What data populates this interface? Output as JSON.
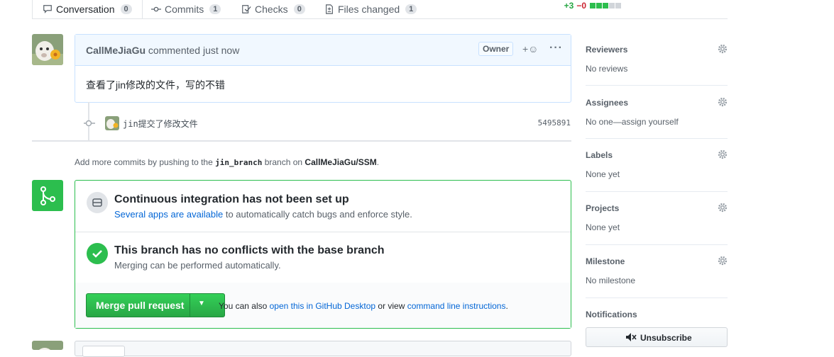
{
  "tabs": {
    "conversation": {
      "label": "Conversation",
      "count": "0"
    },
    "commits": {
      "label": "Commits",
      "count": "1"
    },
    "checks": {
      "label": "Checks",
      "count": "0"
    },
    "files": {
      "label": "Files changed",
      "count": "1"
    }
  },
  "diffstat": {
    "additions": "+3",
    "deletions": "−0"
  },
  "comment": {
    "author": "CallMeJiaGu",
    "action": "commented just now",
    "badge": "Owner",
    "reaction": "+☺",
    "menu": "···",
    "body": "查看了jin修改的文件，写的不错"
  },
  "commit": {
    "message": "jin提交了修改文件",
    "sha": "5495891"
  },
  "hint": {
    "prefix": "Add more commits by pushing to the",
    "branch": "jin_branch",
    "middle": "branch on",
    "repo": "CallMeJiaGu/SSM",
    "end": "."
  },
  "merge": {
    "ci_title": "Continuous integration has not been set up",
    "ci_link": "Several apps are available",
    "ci_rest": "to automatically catch bugs and enforce style.",
    "conflict_title": "This branch has no conflicts with the base branch",
    "conflict_sub": "Merging can be performed automatically.",
    "button": "Merge pull request",
    "also_prefix": "You can also",
    "also_link1": "open this in GitHub Desktop",
    "also_mid": "or view",
    "also_link2": "command line instructions",
    "also_end": "."
  },
  "sidebar": {
    "reviewers": {
      "label": "Reviewers",
      "value": "No reviews"
    },
    "assignees": {
      "label": "Assignees",
      "value": "No one—assign yourself"
    },
    "labels": {
      "label": "Labels",
      "value": "None yet"
    },
    "projects": {
      "label": "Projects",
      "value": "None yet"
    },
    "milestone": {
      "label": "Milestone",
      "value": "No milestone"
    },
    "notifications": {
      "label": "Notifications"
    },
    "unsubscribe": "Unsubscribe"
  },
  "colors": {
    "green": "#2cbe4e",
    "link": "#0366d6",
    "border_blue": "#c8e1ff"
  }
}
